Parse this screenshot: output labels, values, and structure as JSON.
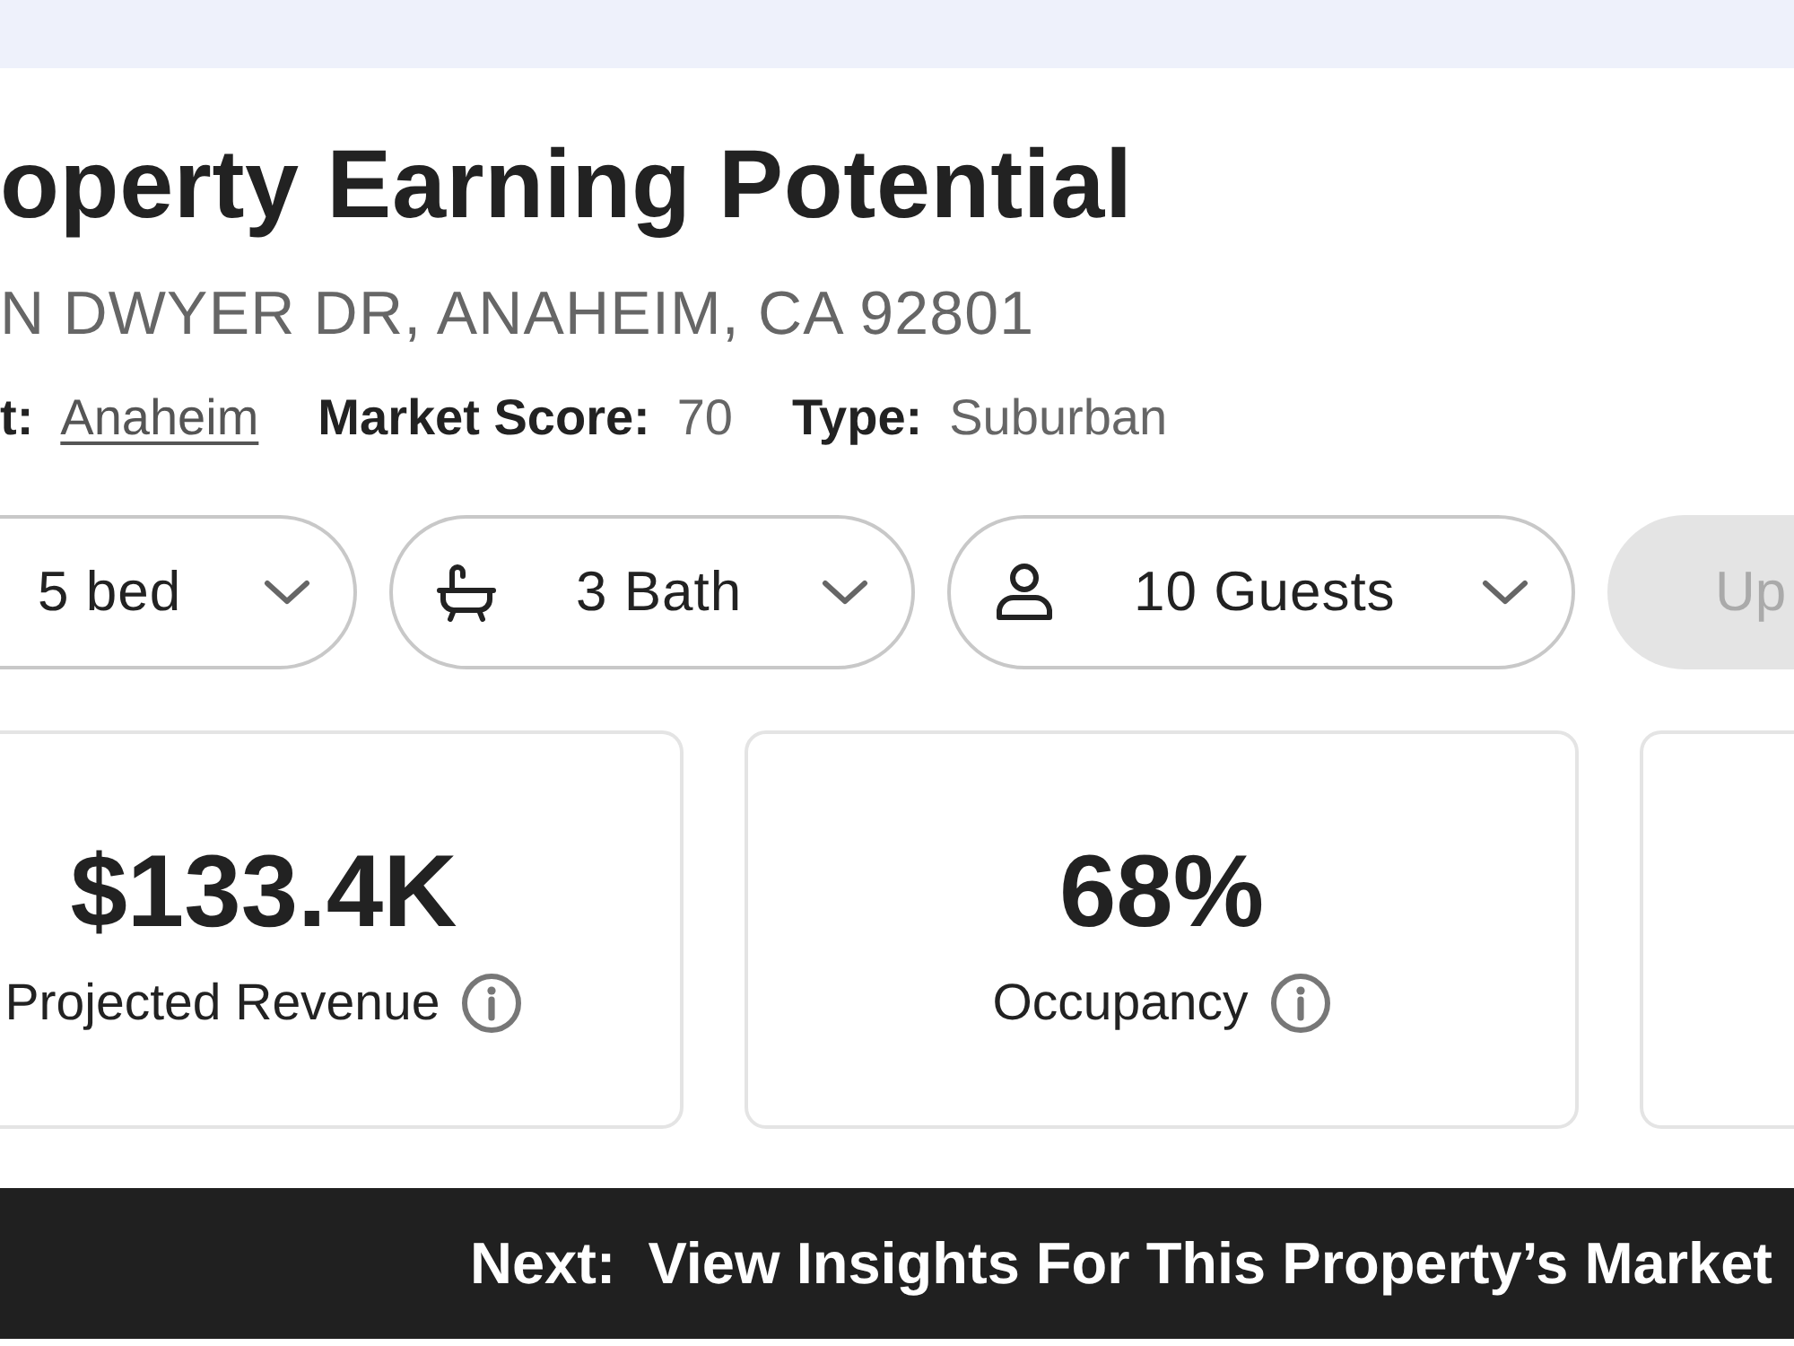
{
  "title": "operty Earning Potential",
  "address": "N DWYER DR, ANAHEIM, CA 92801",
  "meta": [
    {
      "label": "t:",
      "value": "Anaheim",
      "kind": "link"
    },
    {
      "label": "Market Score:",
      "value": "70",
      "kind": "text"
    },
    {
      "label": "Type:",
      "value": "Suburban",
      "kind": "text"
    }
  ],
  "selectors": [
    {
      "label": "5 bed",
      "kind": "plain"
    },
    {
      "label": "3 Bath",
      "kind": "bath"
    },
    {
      "label": "10 Guests",
      "kind": "person"
    }
  ],
  "update_button": {
    "label": "Up",
    "disabled": true
  },
  "metrics": [
    {
      "value": "$133.4K",
      "label": "Projected Revenue"
    },
    {
      "value": "68%",
      "label": "Occupancy"
    }
  ],
  "next_bar": {
    "text": "Next:  View Insights For This Property’s Market"
  }
}
